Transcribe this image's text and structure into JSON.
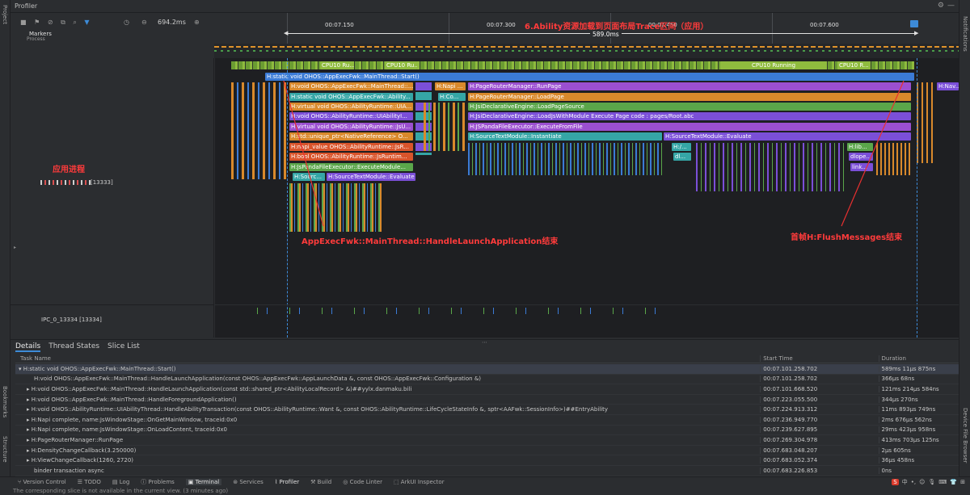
{
  "window": {
    "title": "Profiler"
  },
  "left_strip": {
    "project": "Project",
    "bookmarks": "Bookmarks",
    "structure": "Structure"
  },
  "right_strip": {
    "notifications": "Notifications",
    "device_file_browser": "Device File Browser"
  },
  "toolbar": {
    "zoom_value": "694.2ms"
  },
  "ruler": {
    "t1": "00:07.150",
    "t2": "00:07.300",
    "t3": "00:07.450",
    "t4": "00:07.600",
    "range": "589.0ms"
  },
  "tracks": {
    "markers": "Markers",
    "process": "Process",
    "app_process_note": "应用进程",
    "app_thread": "[13333]",
    "ipc_thread": "IPC_0_13334 [13334]"
  },
  "annotations": {
    "top": "6.Ability资源加载到页面布局Trace区间（应用）",
    "left": "AppExecFwk::MainThread::HandleLaunchApplication结束",
    "right": "首帧H:FlushMessages结束"
  },
  "cpu_labels": [
    "CPU10 Ru...",
    "CPU10 Running",
    "CPU10 R..."
  ],
  "slices": [
    {
      "text": "H:static void OHOS::AppExecFwk::MainThread::Start()",
      "color": "#3b7bd6"
    },
    {
      "text": "H:void OHOS::AppExecFwk::MainThread::...",
      "color": "#d9892b"
    },
    {
      "text": "H:static void OHOS::AppExecFwk::Ability...",
      "color": "#35a6a6"
    },
    {
      "text": "H:virtual void OHOS::AbilityRuntime::UIA...",
      "color": "#d9892b"
    },
    {
      "text": "H:void OHOS::AbilityRuntime::UIAbilityI...",
      "color": "#7b4fd8"
    },
    {
      "text": "H:virtual void OHOS::AbilityRuntime::JsU...",
      "color": "#9b4fd0"
    },
    {
      "text": "H:std::unique_ptr<NativeReference> O...",
      "color": "#d9892b"
    },
    {
      "text": "H:napi_value OHOS::AbilityRuntime::JsR...",
      "color": "#d9542b"
    },
    {
      "text": "H:bool OHOS::AbilityRuntime::JsRuntim...",
      "color": "#d9542b"
    },
    {
      "text": "H:JsPandaFileExecutor::ExecuteModule...",
      "color": "#5aa64a"
    },
    {
      "text": "H:Sourc...",
      "color": "#35a6a6"
    },
    {
      "text": "H:SourceTextModule::Evaluate",
      "color": "#7b4fd8"
    },
    {
      "text": "H:Napi ...",
      "color": "#d9892b"
    },
    {
      "text": "H:Co...",
      "color": "#35a6a6"
    },
    {
      "text": "H:PageRouterManager::RunPage",
      "color": "#9b4fd0"
    },
    {
      "text": "H:PageRouterManager::LoadPage",
      "color": "#d9892b"
    },
    {
      "text": "H:JsiDeclarativeEngine::LoadPageSource",
      "color": "#5aa64a"
    },
    {
      "text": "H:JsiDeclarativeEngine::LoadJsWithModule Execute Page code : pages/Root.abc",
      "color": "#7b4fd8"
    },
    {
      "text": "H:JSPandaFileExecutor::ExecuteFromFile",
      "color": "#9b4fd0"
    },
    {
      "text": "H:SourceTextModule::Instantiate",
      "color": "#35a6a6"
    },
    {
      "text": "H:SourceTextModule::Evaluate",
      "color": "#7b4fd8"
    },
    {
      "text": "H:/...",
      "color": "#35a6a6"
    },
    {
      "text": "dl...",
      "color": "#35a6a6"
    },
    {
      "text": "H:lib...",
      "color": "#5aa64a"
    },
    {
      "text": "dlope...",
      "color": "#7b4fd8"
    },
    {
      "text": "link...",
      "color": "#7b4fd8"
    },
    {
      "text": "H:Nav...",
      "color": "#7b4fd8"
    }
  ],
  "details": {
    "tabs": [
      "Details",
      "Thread States",
      "Slice List"
    ],
    "headers": [
      "Task Name",
      "Start Time",
      "Duration"
    ],
    "rows": [
      {
        "name": "H:static void OHOS::AppExecFwk::MainThread::Start()",
        "start": "00:07.101.258.702",
        "dur": "589ms 11μs 875ns"
      },
      {
        "name": "H:void OHOS::AppExecFwk::MainThread::HandleLaunchApplication(const OHOS::AppExecFwk::AppLaunchData &, const OHOS::AppExecFwk::Configuration &)",
        "start": "00:07.101.258.702",
        "dur": "366μs 68ns"
      },
      {
        "name": "H:void OHOS::AppExecFwk::MainThread::HandleLaunchApplication(const std::shared_ptr<AbilityLocalRecord> &)##yylx.danmaku.bili",
        "start": "00:07.101.668.520",
        "dur": "121ms 214μs 584ns"
      },
      {
        "name": "H:void OHOS::AppExecFwk::MainThread::HandleForegroundApplication()",
        "start": "00:07.223.055.500",
        "dur": "344μs 270ns"
      },
      {
        "name": "H:void OHOS::AbilityRuntime::UIAbilityThread::HandleAbilityTransaction(const OHOS::AbilityRuntime::Want &, const OHOS::AbilityRuntime::LifeCycleStateInfo &, sptr<AAFwk::SessionInfo>)##EntryAbility",
        "start": "00:07.224.913.312",
        "dur": "11ms 893μs 749ns"
      },
      {
        "name": "H:Napi complete, name:JsWindowStage::OnGetMainWindow, traceid:0x0",
        "start": "00:07.236.949.770",
        "dur": "2ms 676μs 562ns"
      },
      {
        "name": "H:Napi complete, name:JsWindowStage::OnLoadContent, traceid:0x0",
        "start": "00:07.239.627.895",
        "dur": "29ms 423μs 958ns"
      },
      {
        "name": "H:PageRouterManager::RunPage",
        "start": "00:07.269.304.978",
        "dur": "413ms 703μs 125ns"
      },
      {
        "name": "H:DensityChangeCallback(3.250000)",
        "start": "00:07.683.048.207",
        "dur": "2μs 605ns"
      },
      {
        "name": "H:ViewChangeCallback(1260, 2720)",
        "start": "00:07.683.052.374",
        "dur": "36μs 458ns"
      },
      {
        "name": "binder transaction async",
        "start": "00:07.683.226.853",
        "dur": "0ns"
      }
    ]
  },
  "bottom_tabs": [
    "Version Control",
    "TODO",
    "Log",
    "Problems",
    "Terminal",
    "Services",
    "Profiler",
    "Build",
    "Code Linter",
    "ArkUI Inspector"
  ],
  "status": "The corresponding slice is not available in the current view. (3 minutes ago)"
}
